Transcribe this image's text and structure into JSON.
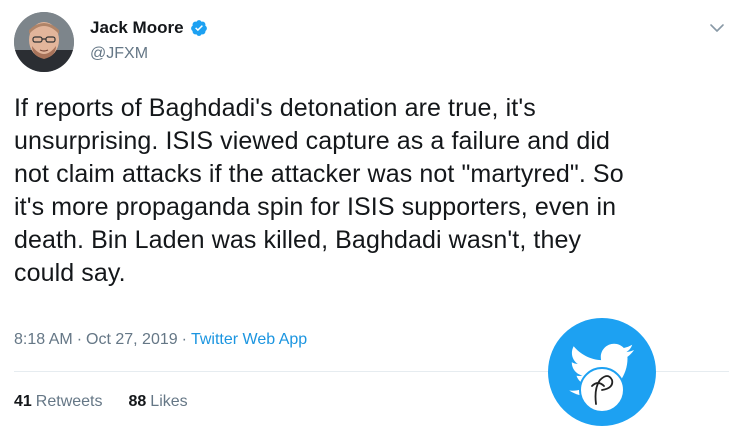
{
  "author": {
    "display_name": "Jack Moore",
    "handle": "@JFXM",
    "verified": true
  },
  "tweet": {
    "text_lines": [
      "If reports of Baghdadi's detonation are true, it's",
      "unsurprising. ISIS viewed capture as a failure and did",
      "not claim attacks if the attacker was not \"martyred\". So",
      "it's more propaganda spin for ISIS supporters, even in",
      "death. Bin Laden was killed, Baghdadi wasn't, they",
      "could say."
    ],
    "time": "8:18 AM",
    "separator": "·",
    "date": "Oct 27, 2019",
    "source": "Twitter Web App"
  },
  "stats": {
    "retweets_count": "41",
    "retweets_label": "Retweets",
    "likes_count": "88",
    "likes_label": "Likes"
  },
  "colors": {
    "accent": "#1da1f2",
    "link": "#1b95e0",
    "secondary_text": "#657786",
    "primary_text": "#14171a"
  },
  "icons": {
    "verified": "verified-badge-icon",
    "caret": "chevron-down-icon",
    "watermark": "bird-logo-watermark"
  }
}
